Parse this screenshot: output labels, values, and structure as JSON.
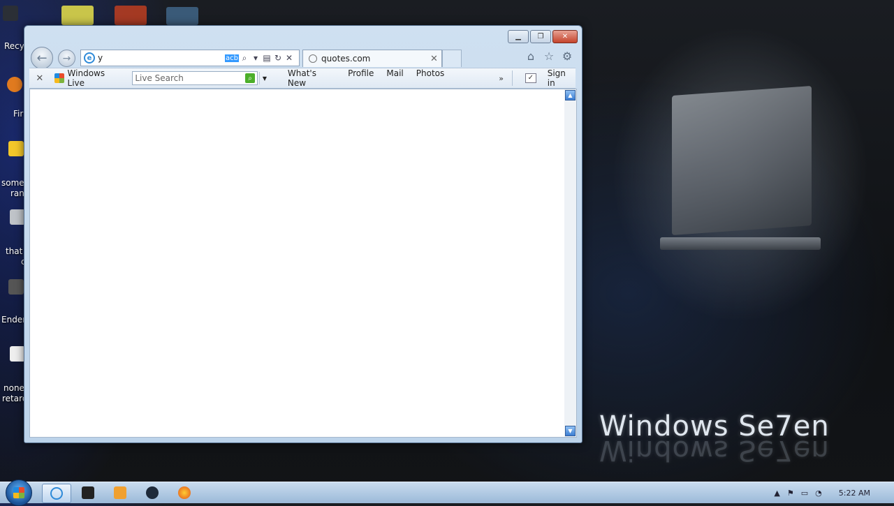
{
  "desktop": {
    "icon_labels": [
      "Recyc",
      "Fir",
      "some",
      "ran",
      "that",
      "c",
      "Ender",
      "none",
      "retard"
    ],
    "wallpaper_text": "Windows Se7en"
  },
  "browser": {
    "address_text": "y",
    "address_selection": "acb",
    "tab_title": "quotes.com",
    "toolbar": {
      "close_glyph": "✕",
      "windows_live_label": "Windows Live",
      "search_placeholder": "Live Search",
      "links": [
        "What's New",
        "Profile",
        "Mail",
        "Photos"
      ],
      "more_glyph": "»",
      "sign_in_label": "Sign in"
    }
  },
  "taskbar": {
    "clock": "5:22 AM"
  }
}
